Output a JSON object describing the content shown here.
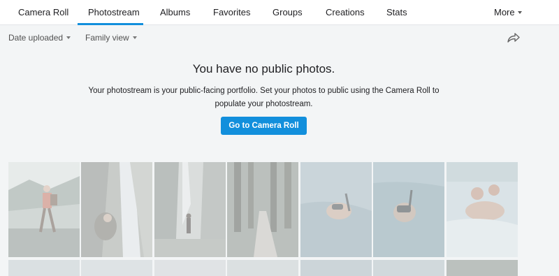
{
  "nav": {
    "tabs": [
      {
        "label": "Camera Roll"
      },
      {
        "label": "Photostream"
      },
      {
        "label": "Albums"
      },
      {
        "label": "Favorites"
      },
      {
        "label": "Groups"
      },
      {
        "label": "Creations"
      },
      {
        "label": "Stats"
      }
    ],
    "more_label": "More",
    "active_tab": "Photostream"
  },
  "filters": {
    "sort_label": "Date uploaded",
    "view_label": "Family view"
  },
  "share_icon": "share-arrow-icon",
  "empty_state": {
    "title": "You have no public photos.",
    "description": "Your photostream is your public-facing portfolio. Set your photos to public using the Camera Roll to populate your photostream.",
    "button_label": "Go to Camera Roll"
  },
  "colors": {
    "accent": "#128fdc",
    "background": "#f3f5f6"
  }
}
